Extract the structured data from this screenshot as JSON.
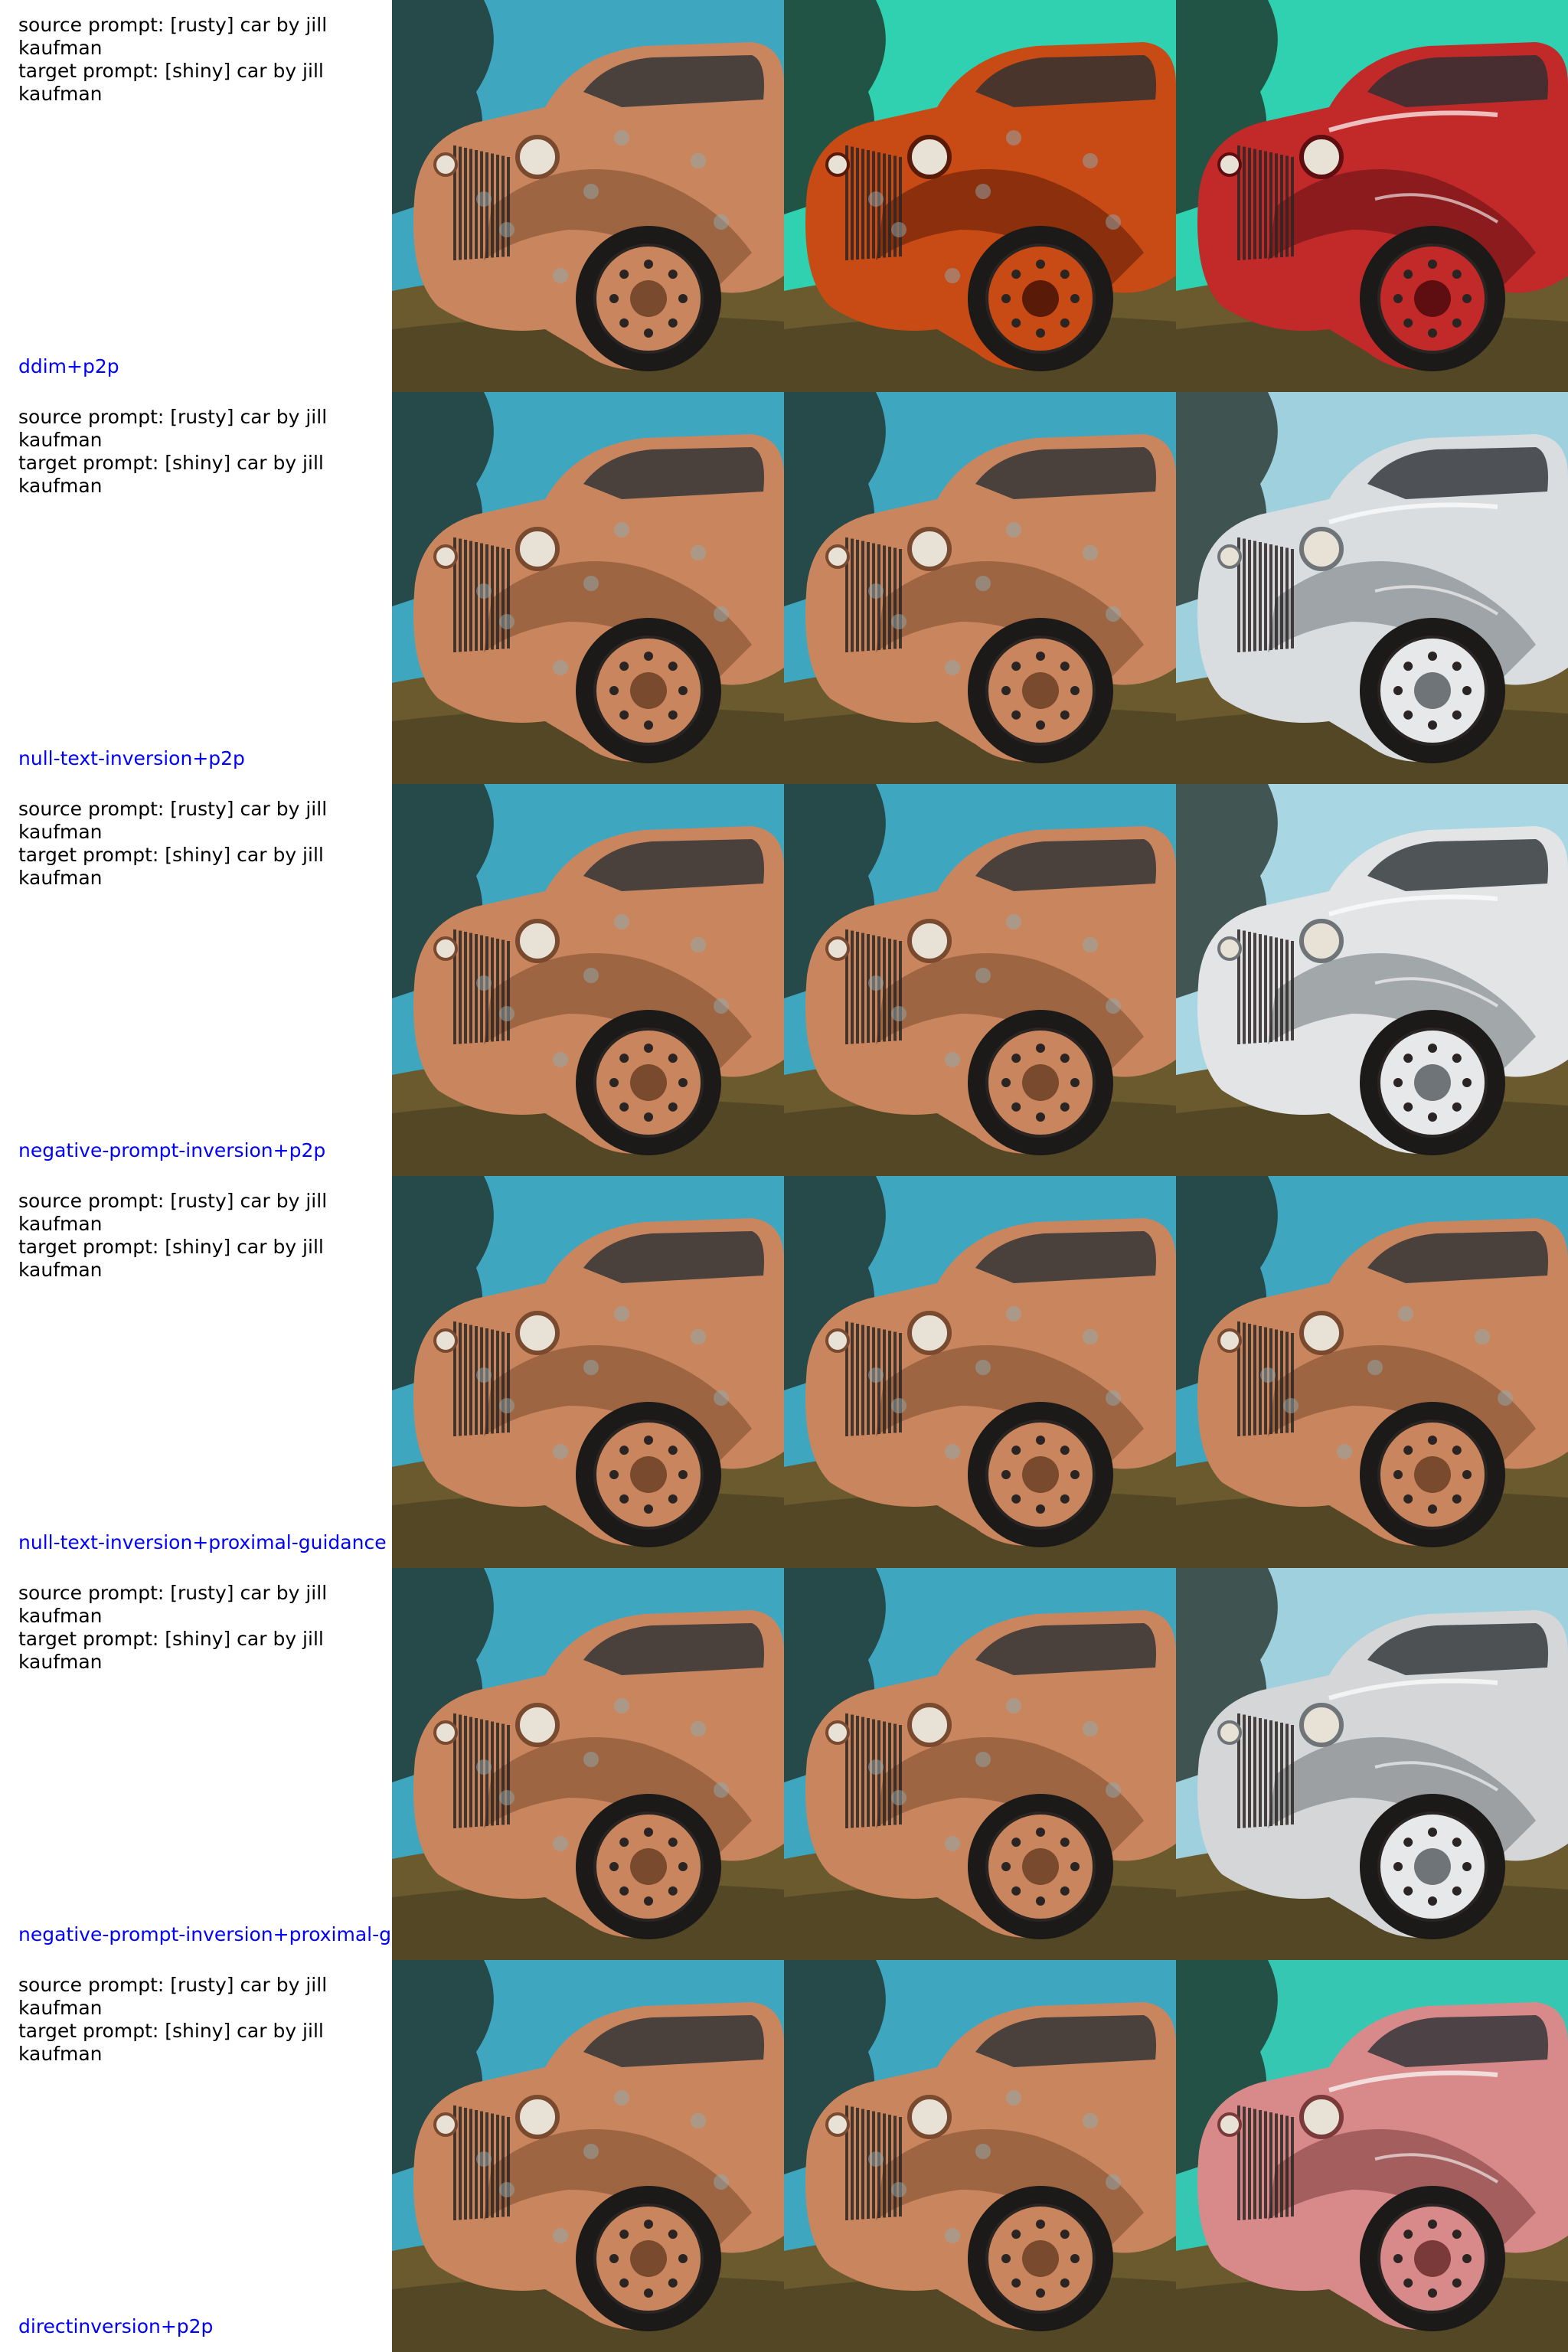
{
  "rows": [
    {
      "source_prompt": "source prompt: [rusty] car by jill kaufman",
      "target_prompt": "target prompt: [shiny] car by jill kaufman",
      "method": "ddim+p2p",
      "images": [
        {
          "semantic": "source-rusty-car",
          "sky": "#3fa6c0",
          "body": "#c9865e",
          "shade": "#7a4a2e",
          "style": "rusty"
        },
        {
          "semantic": "edited-rusty-orange-car",
          "sky": "#2fd1b0",
          "body": "#c84a14",
          "shade": "#5a1a08",
          "style": "rusty-dark"
        },
        {
          "semantic": "edited-red-car",
          "sky": "#2fd1b0",
          "body": "#c22a2a",
          "shade": "#5e0e10",
          "style": "red"
        }
      ]
    },
    {
      "source_prompt": "source prompt: [rusty] car by jill kaufman",
      "target_prompt": "target prompt: [shiny] car by jill kaufman",
      "method": "null-text-inversion+p2p",
      "images": [
        {
          "semantic": "source-rusty-car",
          "sky": "#3fa6c0",
          "body": "#c9865e",
          "shade": "#7a4a2e",
          "style": "rusty"
        },
        {
          "semantic": "reconstructed-rusty-car",
          "sky": "#3fa6c0",
          "body": "#c9865e",
          "shade": "#7a4a2e",
          "style": "rusty"
        },
        {
          "semantic": "edited-silver-car",
          "sky": "#9ed0de",
          "body": "#d9dde0",
          "shade": "#6e7478",
          "style": "silver"
        }
      ]
    },
    {
      "source_prompt": "source prompt: [rusty] car by jill kaufman",
      "target_prompt": "target prompt: [shiny] car by jill kaufman",
      "method": "negative-prompt-inversion+p2p",
      "images": [
        {
          "semantic": "source-rusty-car",
          "sky": "#3fa6c0",
          "body": "#c9865e",
          "shade": "#7a4a2e",
          "style": "rusty"
        },
        {
          "semantic": "reconstructed-rusty-car",
          "sky": "#3fa6c0",
          "body": "#c9865e",
          "shade": "#7a4a2e",
          "style": "rusty"
        },
        {
          "semantic": "edited-silver-car",
          "sky": "#a8d6e2",
          "body": "#e2e4e6",
          "shade": "#6e7478",
          "style": "silver"
        }
      ]
    },
    {
      "source_prompt": "source prompt: [rusty] car by jill kaufman",
      "target_prompt": "target prompt: [shiny] car by jill kaufman",
      "method": "null-text-inversion+proximal-guidance",
      "images": [
        {
          "semantic": "source-rusty-car",
          "sky": "#3fa6c0",
          "body": "#c9865e",
          "shade": "#7a4a2e",
          "style": "rusty"
        },
        {
          "semantic": "reconstructed-rusty-car",
          "sky": "#3fa6c0",
          "body": "#c9865e",
          "shade": "#7a4a2e",
          "style": "rusty"
        },
        {
          "semantic": "edited-rusty-car",
          "sky": "#3fa6c0",
          "body": "#c9865e",
          "shade": "#7a4a2e",
          "style": "rusty"
        }
      ]
    },
    {
      "source_prompt": "source prompt: [rusty] car by jill kaufman",
      "target_prompt": "target prompt: [shiny] car by jill kaufman",
      "method": "negative-prompt-inversion+proximal-guidance",
      "images": [
        {
          "semantic": "source-rusty-car",
          "sky": "#3fa6c0",
          "body": "#c9865e",
          "shade": "#7a4a2e",
          "style": "rusty"
        },
        {
          "semantic": "reconstructed-rusty-car",
          "sky": "#3fa6c0",
          "body": "#c9865e",
          "shade": "#7a4a2e",
          "style": "rusty"
        },
        {
          "semantic": "edited-silver-car",
          "sky": "#9ed0de",
          "body": "#d4d6d8",
          "shade": "#6e7478",
          "style": "silver"
        }
      ]
    },
    {
      "source_prompt": "source prompt: [rusty] car by jill kaufman",
      "target_prompt": "target prompt: [shiny] car by jill kaufman",
      "method": "directinversion+p2p",
      "images": [
        {
          "semantic": "source-rusty-car",
          "sky": "#3fa6c0",
          "body": "#c9865e",
          "shade": "#7a4a2e",
          "style": "rusty"
        },
        {
          "semantic": "reconstructed-rusty-car",
          "sky": "#3fa6c0",
          "body": "#c9865e",
          "shade": "#7a4a2e",
          "style": "rusty"
        },
        {
          "semantic": "edited-pink-car",
          "sky": "#36c7b3",
          "body": "#d88a8a",
          "shade": "#7a3a3a",
          "style": "pink"
        }
      ]
    }
  ]
}
